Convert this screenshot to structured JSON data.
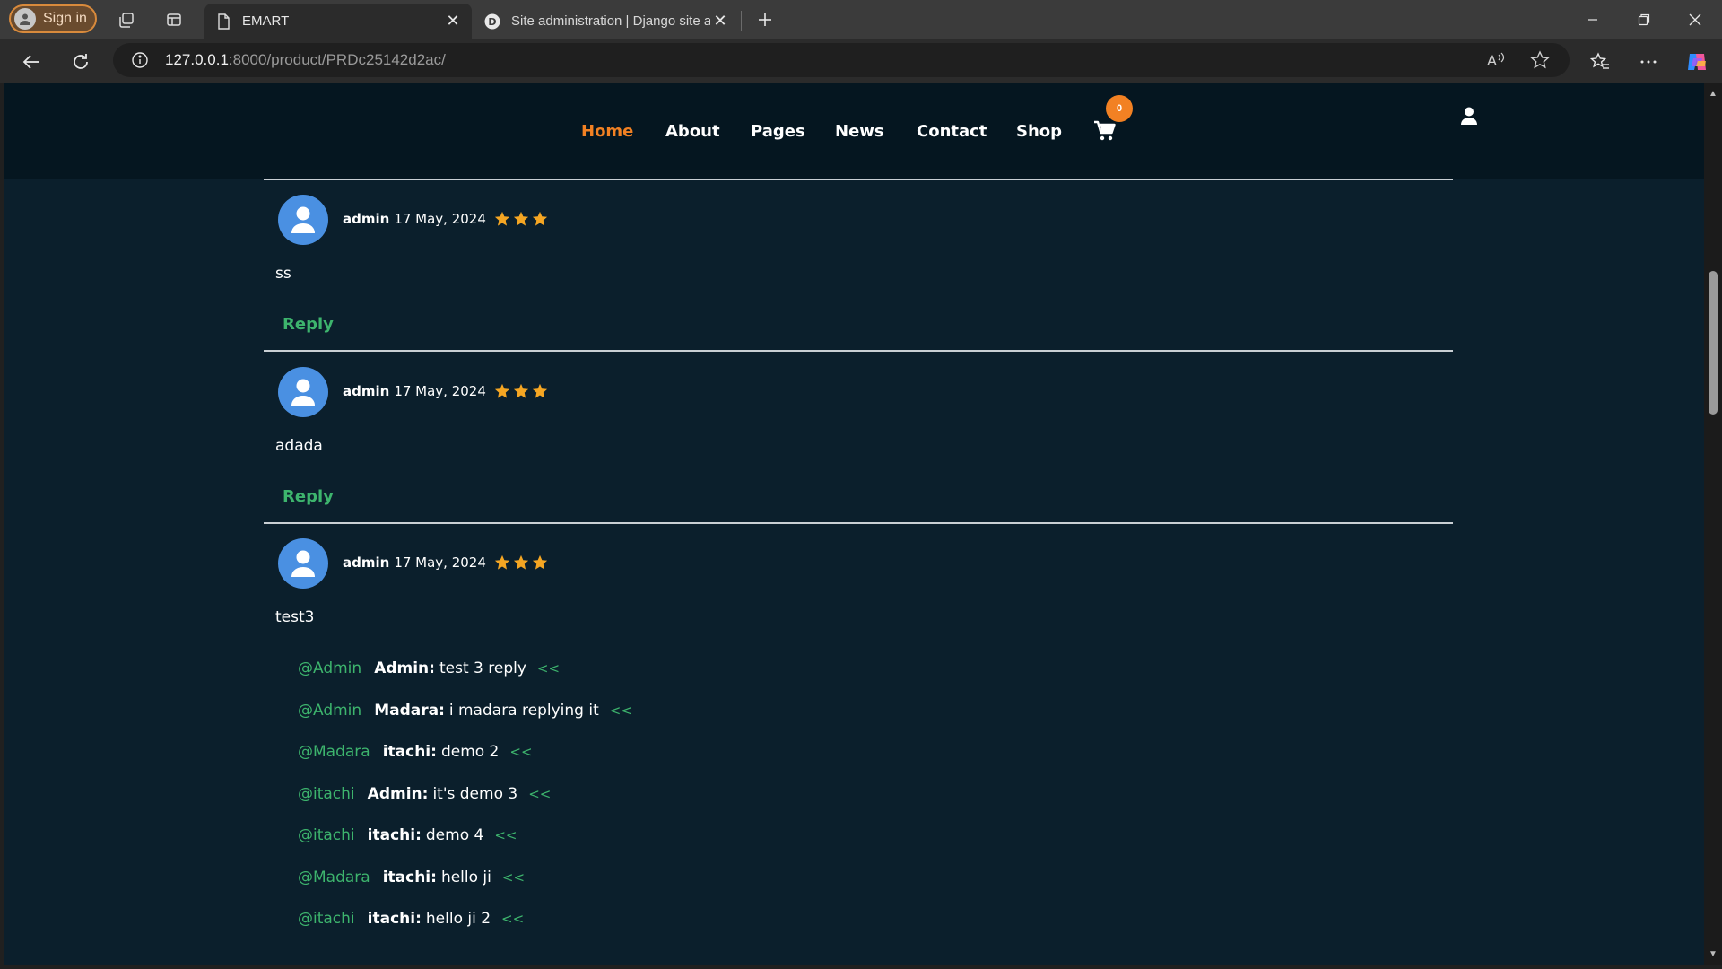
{
  "browser": {
    "signin_label": "Sign in",
    "tabs": [
      {
        "label": "EMART",
        "icon": "document-icon",
        "active": true
      },
      {
        "label": "Site administration | Django site admin",
        "icon": "django-icon",
        "active": false
      }
    ],
    "url_host": "127.0.0.1",
    "url_path": ":8000/product/PRDc25142d2ac/"
  },
  "nav": {
    "items": [
      "Home",
      "About",
      "Pages",
      "News",
      "Contact",
      "Shop"
    ],
    "active": "Home",
    "cart_count": "0"
  },
  "comments": [
    {
      "author": "admin",
      "date": "17 May, 2024",
      "rating": 3,
      "text": "ss",
      "reply_label": "Reply"
    },
    {
      "author": "admin",
      "date": "17 May, 2024",
      "rating": 3,
      "text": "adada",
      "reply_label": "Reply"
    },
    {
      "author": "admin",
      "date": "17 May, 2024",
      "rating": 3,
      "text": "test3"
    }
  ],
  "replies": [
    {
      "mention": "@Admin",
      "author": "Admin:",
      "text": "test 3 reply",
      "back": "<<"
    },
    {
      "mention": "@Admin",
      "author": "Madara:",
      "text": "i madara replying it",
      "back": "<<"
    },
    {
      "mention": "@Madara",
      "author": "itachi:",
      "text": "demo 2",
      "back": "<<"
    },
    {
      "mention": "@itachi",
      "author": "Admin:",
      "text": "it's demo 3",
      "back": "<<"
    },
    {
      "mention": "@itachi",
      "author": "itachi:",
      "text": "demo 4",
      "back": "<<"
    },
    {
      "mention": "@Madara",
      "author": "itachi:",
      "text": "hello ji",
      "back": "<<"
    },
    {
      "mention": "@itachi",
      "author": "itachi:",
      "text": "hello ji 2",
      "back": "<<"
    }
  ],
  "colors": {
    "accent": "#f28123",
    "link_green": "#3db46d",
    "page_bg": "#0b1f2c",
    "header_bg": "#051620",
    "star": "#f5a623",
    "avatar": "#4a90e2"
  }
}
